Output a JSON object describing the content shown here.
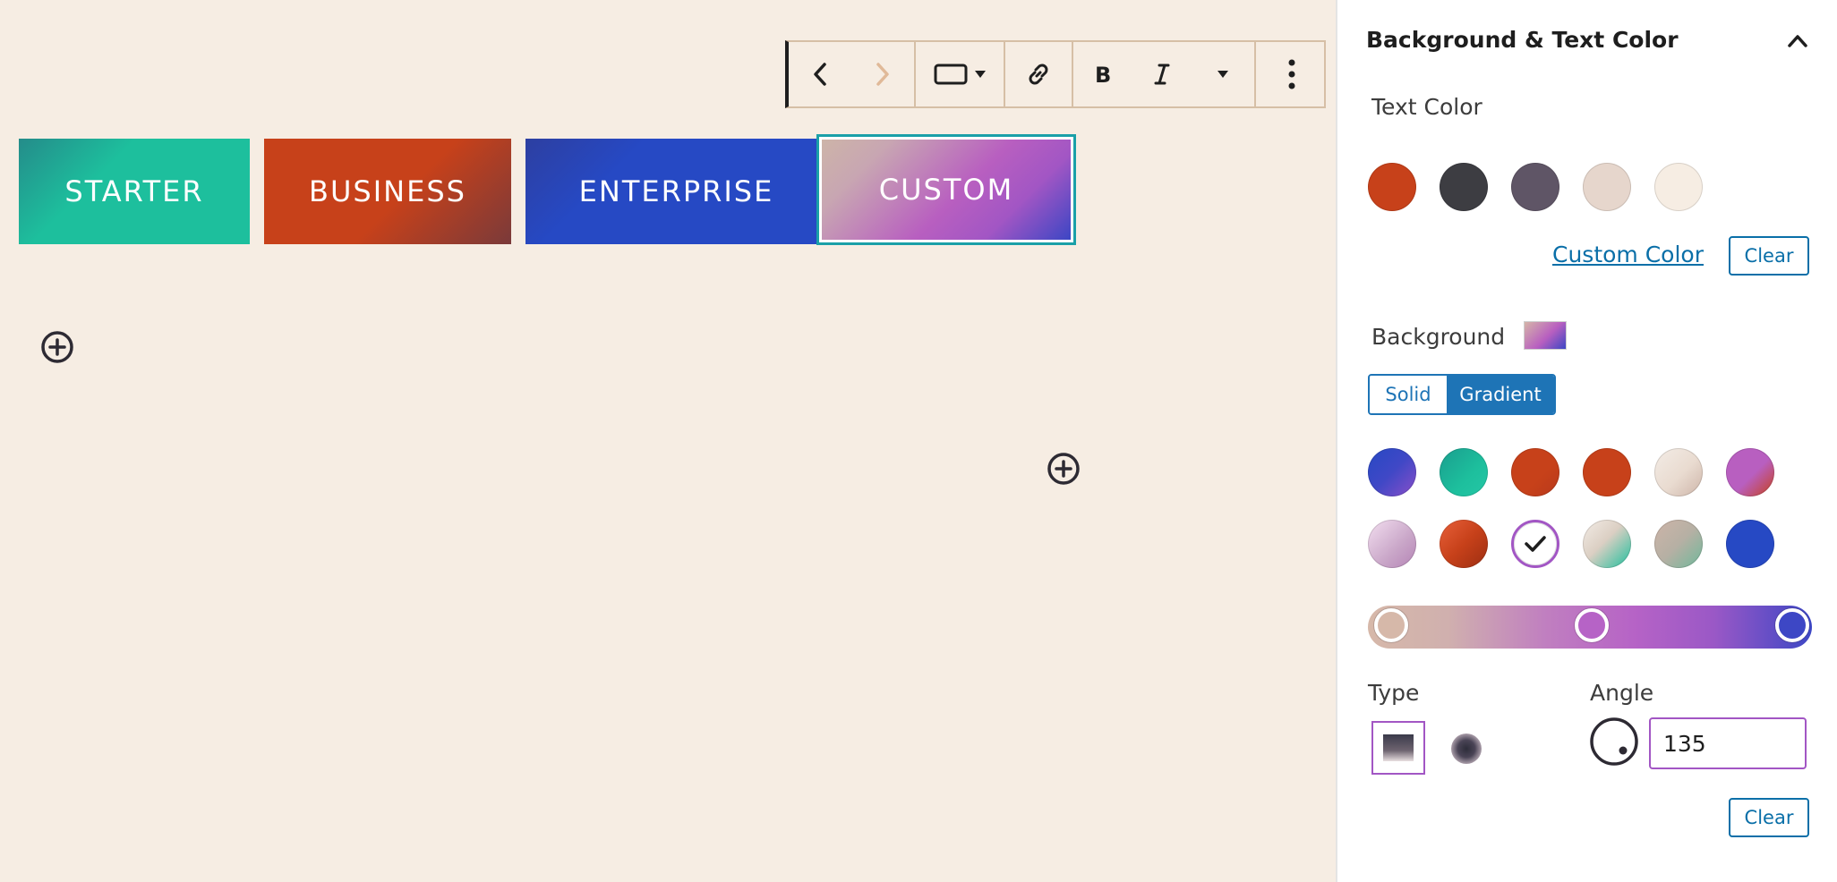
{
  "buttons": {
    "starter": "STARTER",
    "business": "BUSINESS",
    "enterprise": "ENTERPRISE",
    "custom": "CUSTOM"
  },
  "toolbar": {
    "icons": [
      "chevron-left-icon",
      "chevron-right-icon",
      "button-style-icon",
      "dropdown-arrow-icon",
      "link-icon",
      "bold-icon",
      "italic-icon",
      "more-formatting-icon",
      "more-options-icon"
    ]
  },
  "sidebar": {
    "panel_title": "Background & Text Color",
    "text_color": {
      "label": "Text Color",
      "swatches": [
        "#c7411a",
        "#3d3d42",
        "#5f5566",
        "#e6d6cc",
        "#f6ede3"
      ],
      "custom_color_link": "Custom Color",
      "clear_label": "Clear"
    },
    "background": {
      "label": "Background",
      "mode_solid": "Solid",
      "mode_gradient": "Gradient",
      "active_mode": "Gradient",
      "gradient_presets_selected_index": 8,
      "type_label": "Type",
      "angle_label": "Angle",
      "angle_value": "135",
      "clear_label": "Clear",
      "gradient_stops": [
        "#d6b8a9",
        "#b663c6",
        "#3d47c5"
      ]
    }
  },
  "colors": {
    "accent": "#1e74b6",
    "selection_outline": "#1aa0a8",
    "canvas_bg": "#f6ede3"
  }
}
